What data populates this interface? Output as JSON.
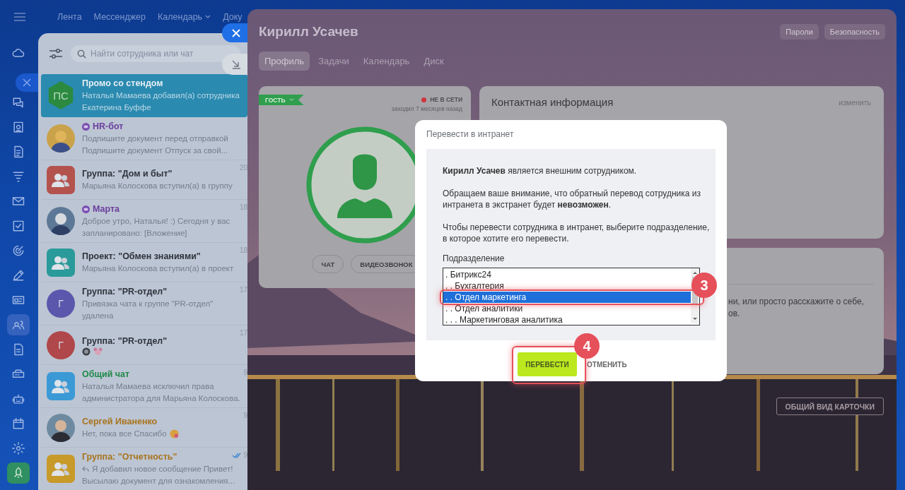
{
  "topnav": [
    {
      "label": "Лента",
      "dropdown": false
    },
    {
      "label": "Мессенджер",
      "dropdown": false
    },
    {
      "label": "Календарь",
      "dropdown": true
    },
    {
      "label": "Доку",
      "dropdown": false
    }
  ],
  "rail": [
    {
      "selected": false
    },
    {
      "selected": false
    },
    {
      "selected": false
    },
    {
      "selected": false
    },
    {
      "selected": false
    },
    {
      "selected": false
    },
    {
      "selected": false
    },
    {
      "selected": false
    },
    {
      "selected": false
    },
    {
      "selected": false
    },
    {
      "selected": true
    },
    {
      "selected": false
    },
    {
      "selected": false
    },
    {
      "selected": false
    },
    {
      "selected": false
    },
    {
      "selected": false
    },
    {
      "selected": false
    }
  ],
  "chat_search": {
    "placeholder": "Найти сотрудника или чат"
  },
  "chats": [
    {
      "name": "Промо со стендом",
      "color": "#e4eef5",
      "bot": false,
      "selected": true,
      "avatar": {
        "kind": "initials",
        "text": "ПС",
        "color": "#2b8a40"
      },
      "preview": [
        "Наталья Мамаева добавил(а) сотрудника",
        "Екатерина Буффе"
      ]
    },
    {
      "name": "HR-бот",
      "color": "#6b3f9e",
      "bot": true,
      "selected": false,
      "avatar": {
        "kind": "picture"
      },
      "preview": [
        "Подпишите документ перед отправкой",
        "Подпишите документ Отпуск за свой..."
      ]
    },
    {
      "name": "Группа: \"Дом и быт\"",
      "color": "#2e333c",
      "bot": false,
      "selected": false,
      "date": "20",
      "avatar": {
        "kind": "group",
        "color": "#b4534e"
      },
      "preview": [
        "Марьяна Колоскова вступил(а) в группу"
      ]
    },
    {
      "name": "Марта",
      "color": "#6b3f9e",
      "bot": true,
      "selected": false,
      "date": "18",
      "avatar": {
        "kind": "picture"
      },
      "preview": [
        "Доброе утро, Наталья! :) Сегодня у вас",
        "запланировано: [Вложение]"
      ]
    },
    {
      "name": "Проект: \"Обмен знаниями\"",
      "color": "#2e333c",
      "bot": false,
      "selected": false,
      "date": "18",
      "avatar": {
        "kind": "group",
        "color": "#2a9a9a"
      },
      "preview": [
        "Марьяна Колоскова вступил(а) в проект"
      ]
    },
    {
      "name": "Группа: \"PR-отдел\"",
      "color": "#2e333c",
      "bot": false,
      "selected": false,
      "date": "17",
      "avatar": {
        "kind": "letter",
        "text": "Г",
        "color": "#5a57ad"
      },
      "preview": [
        "Привязка чата к группе \"PR-отдел\"",
        "удалена"
      ]
    },
    {
      "name": "Группа: \"PR-отдел\"",
      "color": "#2e333c",
      "bot": false,
      "selected": false,
      "date": "17",
      "stickers": true,
      "avatar": {
        "kind": "letter",
        "text": "Г",
        "color": "#b0474a"
      }
    },
    {
      "name": "Общий чат",
      "color": "#1f8a4a",
      "bot": false,
      "selected": false,
      "date": "9",
      "avatar": {
        "kind": "group",
        "color": "#3b9ad6"
      },
      "preview": [
        "Наталья Мамаева исключил права",
        "администратора для Марьяна Колоскова."
      ]
    },
    {
      "name": "Сергей Иваненко",
      "color": "#a8741f",
      "bot": false,
      "selected": false,
      "date": "9",
      "emoji": true,
      "avatar": {
        "kind": "picture"
      },
      "preview": [
        "Нет, пока все Спасибо"
      ]
    },
    {
      "name": "Группа: \"Отчетность\"",
      "color": "#a8741f",
      "bot": false,
      "selected": false,
      "date": "9",
      "read": true,
      "reply": true,
      "avatar": {
        "kind": "group",
        "color": "#c79a2a"
      },
      "preview": [
        "Я добавил новое сообщение Привет!",
        "Высылаю документ для ознакомления..."
      ]
    }
  ],
  "profile": {
    "name": "Кирилл Усачев",
    "buttons": [
      "Пароли",
      "Безопасность"
    ],
    "tabs": [
      {
        "label": "Профиль",
        "selected": true
      },
      {
        "label": "Задачи",
        "selected": false
      },
      {
        "label": "Календарь",
        "selected": false
      },
      {
        "label": "Диск",
        "selected": false
      }
    ],
    "card": {
      "badge": "ГОСТЬ",
      "status": "НЕ В СЕТИ",
      "online": false,
      "last_seen": "заходил 7 месяцев назад",
      "actions": [
        "ЧАТ",
        "ВИДЕОЗВОНОК"
      ]
    },
    "contact": {
      "title": "Контактная информация",
      "edit": "изменить"
    },
    "about": {
      "lines": [
        "ни, или просто расскажите о себе,",
        "ов."
      ]
    },
    "card_view_button": "ОБЩИЙ ВИД КАРТОЧКИ"
  },
  "modal": {
    "title": "Перевести в интранет",
    "paragraphs": [
      "**Кирилл Усачев** является внешним сотрудником.",
      "Обращаем ваше внимание, что обратный перевод сотрудника из интранета в экстранет будет **невозможен**.",
      "Чтобы перевести сотрудника в интранет, выберите подразделение, в которое хотите его перевести."
    ],
    "field_label": "Подразделение",
    "options": [
      {
        "label": ". Битрикс24",
        "selected": false
      },
      {
        "label": ". . Бухгалтерия",
        "selected": false
      },
      {
        "label": ". . Отдел маркетинга",
        "selected": true
      },
      {
        "label": ". . Отдел аналитики",
        "selected": false
      },
      {
        "label": ". . . Маркетинговая аналитика",
        "selected": false
      }
    ],
    "buttons": [
      {
        "label": "ПЕРЕВЕСТИ",
        "kind": "primary"
      },
      {
        "label": "ОТМЕНИТЬ",
        "kind": "link"
      }
    ]
  },
  "annotations": [
    {
      "label": "3"
    },
    {
      "label": "4"
    }
  ]
}
